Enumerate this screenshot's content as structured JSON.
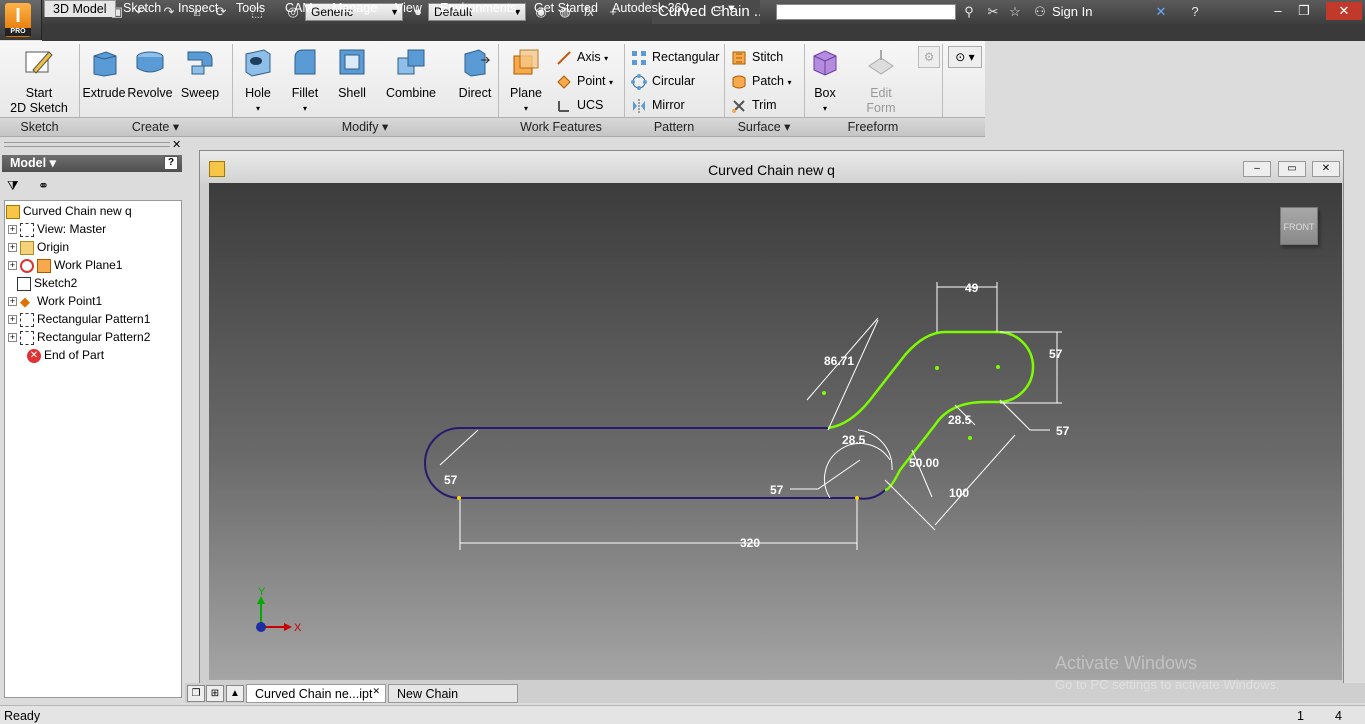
{
  "app": {
    "title": "Curved Chain ...",
    "badge": "PRO"
  },
  "qat": {
    "style_dropdown": "Generic",
    "appearance_dropdown": "Default",
    "search_placeholder": "",
    "sign_in": "Sign In"
  },
  "tabs": [
    "3D Model",
    "Sketch",
    "Inspect",
    "Tools",
    "CAM",
    "Manage",
    "View",
    "Environments",
    "Get Started",
    "Autodesk 360"
  ],
  "ribbon": {
    "start_sketch": [
      "Start",
      "2D Sketch"
    ],
    "extrude": "Extrude",
    "revolve": "Revolve",
    "sweep": "Sweep",
    "hole": "Hole",
    "fillet": "Fillet",
    "shell": "Shell",
    "combine": "Combine",
    "direct": "Direct",
    "plane": "Plane",
    "axis": "Axis",
    "point": "Point",
    "ucs": "UCS",
    "rectangular": "Rectangular",
    "circular": "Circular",
    "mirror": "Mirror",
    "stitch": "Stitch",
    "patch": "Patch",
    "trim": "Trim",
    "box": "Box",
    "edit_form": [
      "Edit",
      "Form"
    ],
    "panels": [
      "Sketch",
      "Create ▾",
      "Modify ▾",
      "Work Features",
      "Pattern",
      "Surface ▾",
      "Freeform"
    ]
  },
  "browser": {
    "header": "Model ▾",
    "items": [
      {
        "label": "Curved Chain new q",
        "expand": ""
      },
      {
        "label": "View: Master",
        "expand": "+"
      },
      {
        "label": "Origin",
        "expand": "+"
      },
      {
        "label": "Work Plane1",
        "expand": "+"
      },
      {
        "label": "Sketch2",
        "expand": ""
      },
      {
        "label": "Work Point1",
        "expand": "+"
      },
      {
        "label": "Rectangular Pattern1",
        "expand": "+"
      },
      {
        "label": "Rectangular Pattern2",
        "expand": "+"
      },
      {
        "label": "End of Part",
        "expand": ""
      }
    ]
  },
  "document": {
    "title": "Curved Chain new q",
    "viewcube": "FRONT"
  },
  "sketch_dims": {
    "d49": "49",
    "d8671": "86.71",
    "d57a": "57",
    "d285a": "28.5",
    "d285b": "28.5",
    "d5000": "50.00",
    "d57b": "57",
    "d57c": "57",
    "d57d": "57",
    "d100": "100",
    "d320": "320"
  },
  "axis": {
    "x": "X",
    "y": "Y"
  },
  "doc_tabs": [
    "Curved Chain ne...ipt",
    "New Chain asse...iam"
  ],
  "status": {
    "text": "Ready",
    "n1": "1",
    "n2": "4"
  },
  "watermark": {
    "line1": "Activate Windows",
    "line2": "Go to PC settings to activate Windows."
  },
  "colors": {
    "sketch_curve": "#2a1a6e",
    "sketch_green": "#7cfc00",
    "dims": "#ffffff"
  }
}
